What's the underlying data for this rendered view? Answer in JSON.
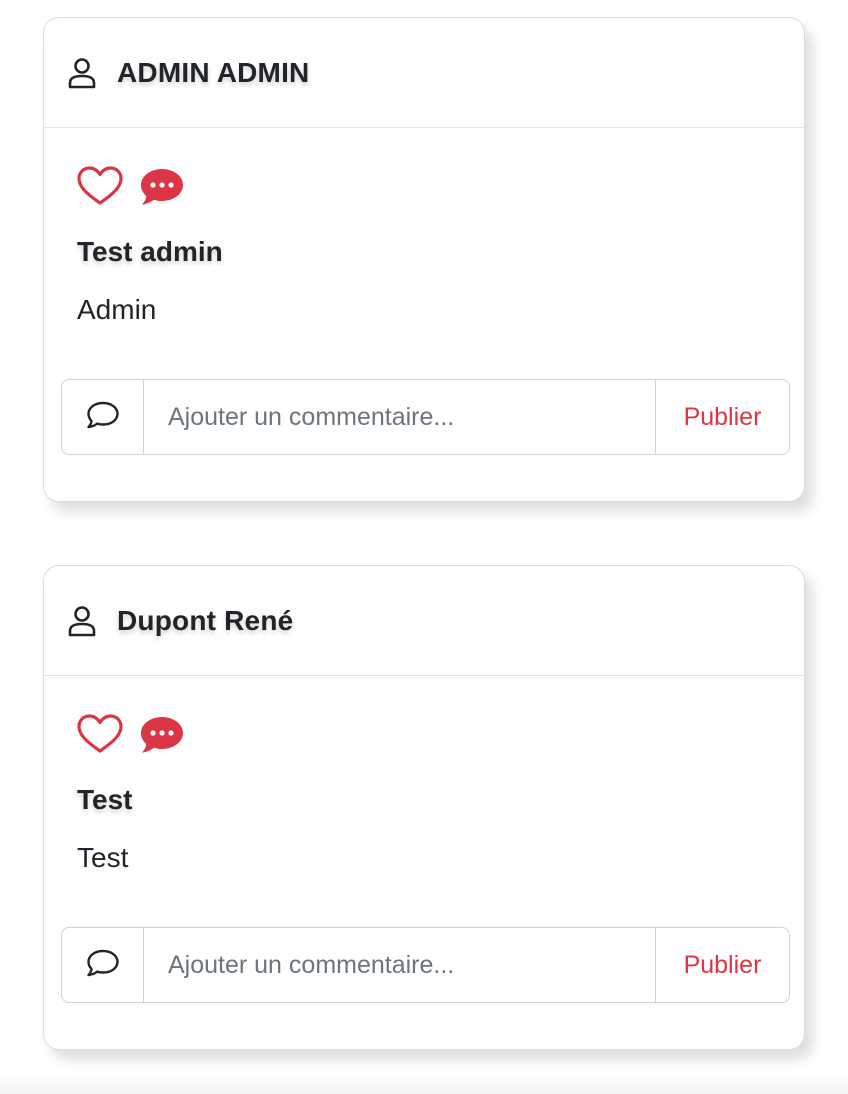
{
  "colors": {
    "accent": "#dc3545",
    "text": "#212529",
    "placeholder": "#6c757d",
    "border": "#cfd3d7"
  },
  "posts": [
    {
      "author": "ADMIN ADMIN",
      "title": "Test admin",
      "text": "Admin",
      "comment_placeholder": "Ajouter un commentaire...",
      "publish_label": "Publier",
      "icons": [
        "person-icon",
        "heart-outline-icon",
        "chat-dots-fill-icon",
        "chat-outline-icon"
      ]
    },
    {
      "author": "Dupont René",
      "title": "Test",
      "text": "Test",
      "comment_placeholder": "Ajouter un commentaire...",
      "publish_label": "Publier",
      "icons": [
        "person-icon",
        "heart-outline-icon",
        "chat-dots-fill-icon",
        "chat-outline-icon"
      ]
    }
  ]
}
